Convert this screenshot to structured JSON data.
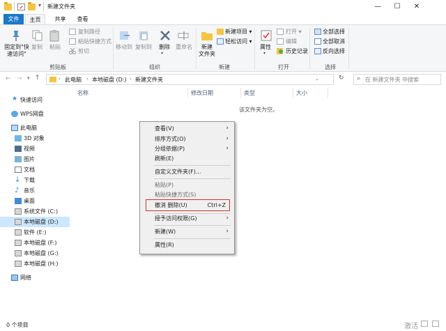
{
  "window": {
    "title": "新建文件夹",
    "controls": {
      "minimize": "—",
      "maximize": "☐",
      "close": "✕"
    },
    "qa_dropdown": "▾"
  },
  "ribbon_tabs": [
    {
      "label": "文件",
      "active": true
    },
    {
      "label": "主页",
      "active": false
    },
    {
      "label": "共享",
      "active": false
    },
    {
      "label": "查看",
      "active": false
    }
  ],
  "ribbon": {
    "clipboard": {
      "pin_line1": "固定到\"快",
      "pin_line2": "速访问\"",
      "copy": "复制",
      "paste": "粘贴",
      "copy_path": "复制路径",
      "paste_shortcut": "粘贴快捷方式",
      "cut": "剪切",
      "group_label": "剪贴板"
    },
    "organize": {
      "move_to": "移动到",
      "copy_to": "复制到",
      "delete": "删除",
      "rename": "重命名",
      "group_label": "组织"
    },
    "new": {
      "new_folder_line1": "新建",
      "new_folder_line2": "文件夹",
      "new_item": "新建项目",
      "easy_access": "轻松访问",
      "group_label": "新建"
    },
    "open": {
      "properties": "属性",
      "open": "打开",
      "edit": "编辑",
      "history": "历史记录",
      "group_label": "打开"
    },
    "select": {
      "select_all": "全部选择",
      "select_none": "全部取消",
      "invert": "反向选择",
      "group_label": "选择"
    }
  },
  "address": {
    "path": [
      "此电脑",
      "本地磁盘 (D:)",
      "新建文件夹"
    ],
    "search_placeholder": "在 新建文件夹 中搜索"
  },
  "nav": {
    "items": [
      {
        "label": "快速访问",
        "icon": "star-icon",
        "selected": false
      },
      {
        "label": "WPS网盘",
        "icon": "cloud-icon",
        "selected": false
      },
      {
        "label": "此电脑",
        "icon": "computer-icon",
        "selected": false
      },
      {
        "label": "3D 对象",
        "icon": "3d-objects-icon",
        "selected": false
      },
      {
        "label": "视频",
        "icon": "video-icon",
        "selected": false
      },
      {
        "label": "图片",
        "icon": "pictures-icon",
        "selected": false
      },
      {
        "label": "文档",
        "icon": "documents-icon",
        "selected": false
      },
      {
        "label": "下载",
        "icon": "download-icon",
        "selected": false
      },
      {
        "label": "音乐",
        "icon": "music-icon",
        "selected": false
      },
      {
        "label": "桌面",
        "icon": "desktop-icon",
        "selected": false
      },
      {
        "label": "系统文件 (C:)",
        "icon": "drive-icon",
        "selected": false
      },
      {
        "label": "本地磁盘 (D:)",
        "icon": "drive-icon",
        "selected": true
      },
      {
        "label": "软件 (E:)",
        "icon": "drive-icon",
        "selected": false
      },
      {
        "label": "本地磁盘 (F:)",
        "icon": "drive-icon",
        "selected": false
      },
      {
        "label": "本地磁盘 (G:)",
        "icon": "drive-icon",
        "selected": false
      },
      {
        "label": "本地磁盘 (H:)",
        "icon": "drive-icon",
        "selected": false
      },
      {
        "label": "网络",
        "icon": "network-icon",
        "selected": false
      }
    ]
  },
  "columns": [
    "名称",
    "修改日期",
    "类型",
    "大小"
  ],
  "empty_message": "该文件夹为空。",
  "context_menu": {
    "items": [
      {
        "label": "查看(V)",
        "submenu": true,
        "disabled": false
      },
      {
        "label": "排序方式(O)",
        "submenu": true,
        "disabled": false
      },
      {
        "label": "分组依据(P)",
        "submenu": true,
        "disabled": false
      },
      {
        "label": "刷新(E)",
        "submenu": false,
        "disabled": false
      },
      {
        "label": "自定义文件夹(F)...",
        "submenu": false,
        "disabled": false
      },
      {
        "label": "粘贴(P)",
        "submenu": false,
        "disabled": true
      },
      {
        "label": "粘贴快捷方式(S)",
        "submenu": false,
        "disabled": true
      },
      {
        "label": "撤消 删除(U)",
        "shortcut": "Ctrl+Z",
        "submenu": false,
        "disabled": false,
        "highlighted_box": true
      },
      {
        "label": "授予访问权限(G)",
        "submenu": true,
        "disabled": false
      },
      {
        "label": "新建(W)",
        "submenu": true,
        "disabled": false
      },
      {
        "label": "属性(R)",
        "submenu": false,
        "disabled": false
      }
    ]
  },
  "status": {
    "count": "0 个项目"
  },
  "watermark": "激活",
  "colors": {
    "accent": "#1979ca",
    "selection": "#cce8ff",
    "highlight_box": "#d0312d",
    "folder": "#f5c542"
  }
}
